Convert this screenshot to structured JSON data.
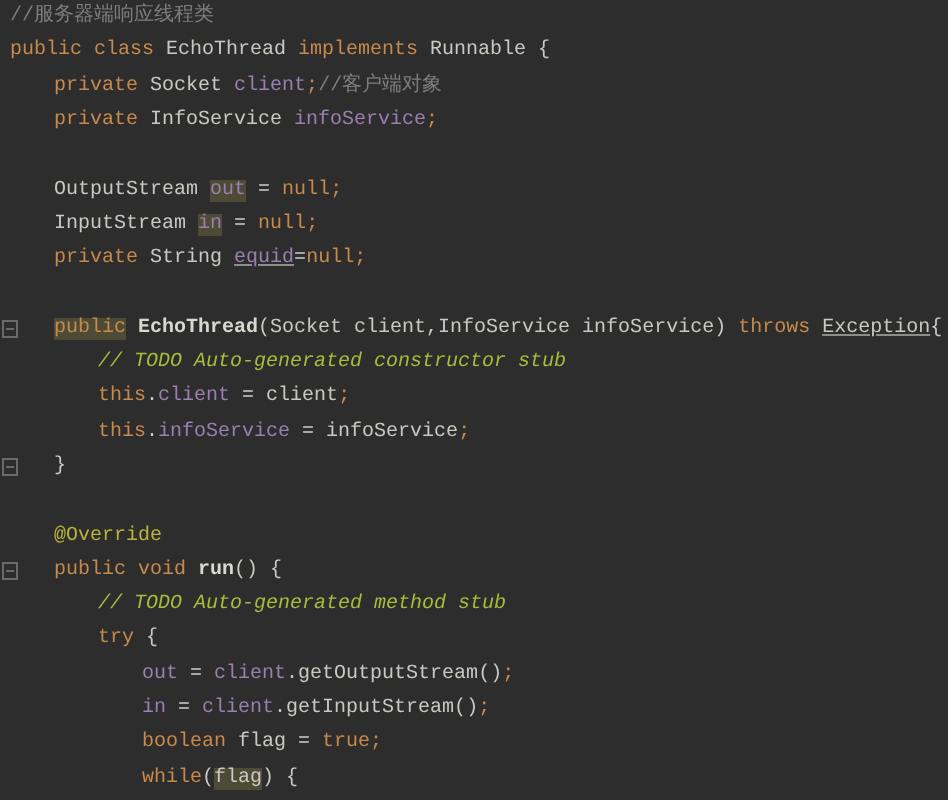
{
  "editor": {
    "lines": [
      {
        "kind": "code",
        "tokens": [
          {
            "t": "//服务器端响应线程类",
            "kind": "comment"
          }
        ]
      },
      {
        "kind": "code",
        "tokens": [
          {
            "t": "public class ",
            "kind": "kw"
          },
          {
            "t": "EchoThread ",
            "kind": "plain"
          },
          {
            "t": "implements ",
            "kind": "kw"
          },
          {
            "t": "Runnable {",
            "kind": "plain"
          }
        ],
        "children": [
          {
            "kind": "code",
            "tokens": [
              {
                "t": "private ",
                "kind": "kw"
              },
              {
                "t": "Socket ",
                "kind": "plain"
              },
              {
                "t": "client",
                "kind": "field"
              },
              {
                "t": ";",
                "kind": "kw"
              },
              {
                "t": "//客户端对象",
                "kind": "comment"
              }
            ]
          },
          {
            "kind": "code",
            "tokens": [
              {
                "t": "private ",
                "kind": "kw"
              },
              {
                "t": "InfoService ",
                "kind": "plain"
              },
              {
                "t": "infoService",
                "kind": "field"
              },
              {
                "t": ";",
                "kind": "kw"
              }
            ]
          },
          {
            "kind": "blank"
          },
          {
            "kind": "code",
            "tokens": [
              {
                "t": "OutputStream ",
                "kind": "plain"
              },
              {
                "t": "out",
                "kind": "field",
                "hl": true
              },
              {
                "t": " = ",
                "kind": "plain"
              },
              {
                "t": "null",
                "kind": "kw"
              },
              {
                "t": ";",
                "kind": "kw"
              }
            ]
          },
          {
            "kind": "code",
            "tokens": [
              {
                "t": "InputStream ",
                "kind": "plain"
              },
              {
                "t": "in",
                "kind": "field",
                "hl": true
              },
              {
                "t": " = ",
                "kind": "plain"
              },
              {
                "t": "null",
                "kind": "kw"
              },
              {
                "t": ";",
                "kind": "kw"
              }
            ]
          },
          {
            "kind": "code",
            "tokens": [
              {
                "t": "private ",
                "kind": "kw"
              },
              {
                "t": "String ",
                "kind": "plain"
              },
              {
                "t": "equid",
                "kind": "field",
                "ul": true
              },
              {
                "t": "=",
                "kind": "plain"
              },
              {
                "t": "null",
                "kind": "kw"
              },
              {
                "t": ";",
                "kind": "kw"
              }
            ]
          },
          {
            "kind": "blank"
          },
          {
            "kind": "code",
            "fold": true,
            "tokens": [
              {
                "t": "public",
                "kind": "kw",
                "hl": true
              },
              {
                "t": " EchoThread",
                "kind": "decl"
              },
              {
                "t": "(Socket client,InfoService infoService) ",
                "kind": "plain"
              },
              {
                "t": "throws ",
                "kind": "kw"
              },
              {
                "t": "Exception",
                "kind": "plain",
                "ul": true
              },
              {
                "t": "{",
                "kind": "plain"
              }
            ],
            "children": [
              {
                "kind": "code",
                "tokens": [
                  {
                    "t": "// TODO Auto-generated constructor stub",
                    "kind": "todo"
                  }
                ]
              },
              {
                "kind": "code",
                "tokens": [
                  {
                    "t": "this",
                    "kind": "kw"
                  },
                  {
                    "t": ".",
                    "kind": "plain"
                  },
                  {
                    "t": "client",
                    "kind": "field"
                  },
                  {
                    "t": " = client",
                    "kind": "plain"
                  },
                  {
                    "t": ";",
                    "kind": "kw"
                  }
                ]
              },
              {
                "kind": "code",
                "tokens": [
                  {
                    "t": "this",
                    "kind": "kw"
                  },
                  {
                    "t": ".",
                    "kind": "plain"
                  },
                  {
                    "t": "infoService",
                    "kind": "field"
                  },
                  {
                    "t": " = infoService",
                    "kind": "plain"
                  },
                  {
                    "t": ";",
                    "kind": "kw"
                  }
                ]
              }
            ]
          },
          {
            "kind": "code",
            "fold": true,
            "tokens": [
              {
                "t": "}",
                "kind": "plain"
              }
            ]
          },
          {
            "kind": "blank"
          },
          {
            "kind": "code",
            "tokens": [
              {
                "t": "@Override",
                "kind": "ann"
              }
            ]
          },
          {
            "kind": "code",
            "fold": true,
            "tokens": [
              {
                "t": "public void ",
                "kind": "kw"
              },
              {
                "t": "run",
                "kind": "decl"
              },
              {
                "t": "() {",
                "kind": "plain"
              }
            ],
            "children": [
              {
                "kind": "code",
                "tokens": [
                  {
                    "t": "// TODO Auto-generated method stub",
                    "kind": "todo"
                  }
                ]
              },
              {
                "kind": "code",
                "tokens": [
                  {
                    "t": "try ",
                    "kind": "kw"
                  },
                  {
                    "t": "{",
                    "kind": "plain"
                  }
                ],
                "children": [
                  {
                    "kind": "code",
                    "tokens": [
                      {
                        "t": "out",
                        "kind": "field"
                      },
                      {
                        "t": " = ",
                        "kind": "plain"
                      },
                      {
                        "t": "client",
                        "kind": "field"
                      },
                      {
                        "t": ".getOutputStream()",
                        "kind": "plain"
                      },
                      {
                        "t": ";",
                        "kind": "kw"
                      }
                    ]
                  },
                  {
                    "kind": "code",
                    "tokens": [
                      {
                        "t": "in",
                        "kind": "field"
                      },
                      {
                        "t": " = ",
                        "kind": "plain"
                      },
                      {
                        "t": "client",
                        "kind": "field"
                      },
                      {
                        "t": ".getInputStream()",
                        "kind": "plain"
                      },
                      {
                        "t": ";",
                        "kind": "kw"
                      }
                    ]
                  },
                  {
                    "kind": "code",
                    "tokens": [
                      {
                        "t": "boolean ",
                        "kind": "kw"
                      },
                      {
                        "t": "flag = ",
                        "kind": "plain"
                      },
                      {
                        "t": "true",
                        "kind": "kw"
                      },
                      {
                        "t": ";",
                        "kind": "kw"
                      }
                    ]
                  },
                  {
                    "kind": "code",
                    "tokens": [
                      {
                        "t": "while",
                        "kind": "kw"
                      },
                      {
                        "t": "(",
                        "kind": "plain"
                      },
                      {
                        "t": "flag",
                        "kind": "plain",
                        "hl": true
                      },
                      {
                        "t": ") {",
                        "kind": "plain"
                      }
                    ]
                  }
                ]
              }
            ]
          }
        ]
      }
    ]
  }
}
